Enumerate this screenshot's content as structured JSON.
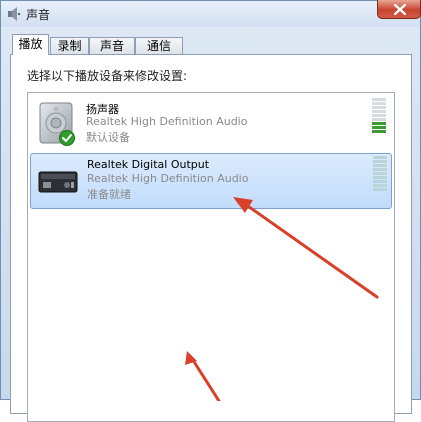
{
  "window": {
    "title": "声音"
  },
  "tabs": [
    {
      "label": "播放",
      "active": true
    },
    {
      "label": "录制",
      "active": false
    },
    {
      "label": "声音",
      "active": false
    },
    {
      "label": "通信",
      "active": false
    }
  ],
  "panel": {
    "instruction": "选择以下播放设备来修改设置:"
  },
  "devices": [
    {
      "name": "扬声器",
      "driver": "Realtek High Definition Audio",
      "status": "默认设备",
      "icon": "speaker-icon",
      "badge": "default-check-icon",
      "selected": false
    },
    {
      "name": "Realtek Digital Output",
      "driver": "Realtek High Definition Audio",
      "status": "准备就绪",
      "icon": "digital-output-icon",
      "selected": true
    }
  ],
  "colors": {
    "accent_selection": "#c1dcfc",
    "meter_active": "#3c9c34",
    "meter_idle": "#d2d6da",
    "arrow": "#d8402a"
  }
}
